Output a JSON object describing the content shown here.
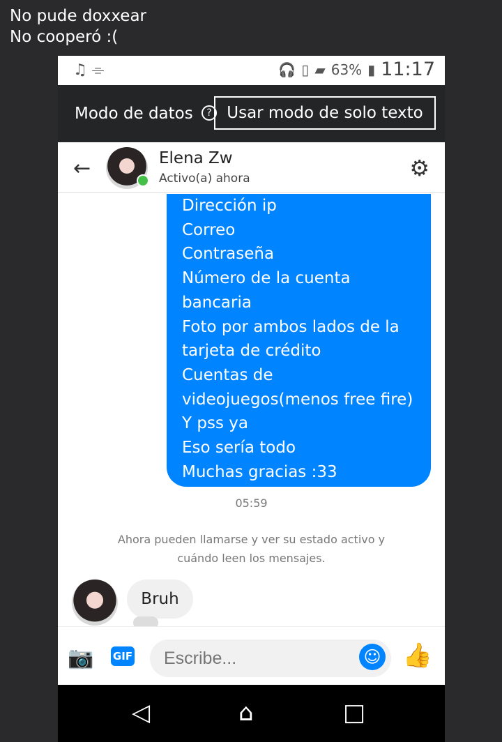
{
  "caption": [
    "No pude doxxear",
    "No cooperó :("
  ],
  "status_bar": {
    "left_icons": "♫  ⌯",
    "battery": "63%",
    "time": "11:17"
  },
  "data_mode": {
    "label": "Modo de datos",
    "help_icon": "?",
    "button": "Usar modo de solo texto"
  },
  "header": {
    "name": "Elena Zw",
    "status": "Activo(a) ahora"
  },
  "message_lines": [
    "Dirección ip",
    "Correo",
    "Contraseña",
    "Número de la cuenta",
    "bancaria",
    "Foto por ambos lados de la",
    "tarjeta de crédito",
    "Cuentas de",
    "videojuegos(menos free fire)",
    "Y pss ya",
    "Eso sería todo",
    "Muchas gracias :33"
  ],
  "timestamp": "05:59",
  "notice": "Ahora pueden llamarse y ver su estado activo y cuándo leen los mensajes.",
  "received_message": "Bruh",
  "composer": {
    "placeholder": "Escribe...",
    "gif_label": "GIF"
  },
  "icons": [
    "music-icon",
    "signal-icon",
    "headphones-icon",
    "vibrate-icon",
    "back-arrow-icon",
    "settings-icon",
    "camera-icon",
    "gif-icon",
    "emoji-icon",
    "like-icon",
    "nav-back-icon",
    "home-icon",
    "recents-icon"
  ],
  "colors": {
    "accent": "#0084ff",
    "dark_bar": "#242526",
    "online": "#44c048"
  }
}
